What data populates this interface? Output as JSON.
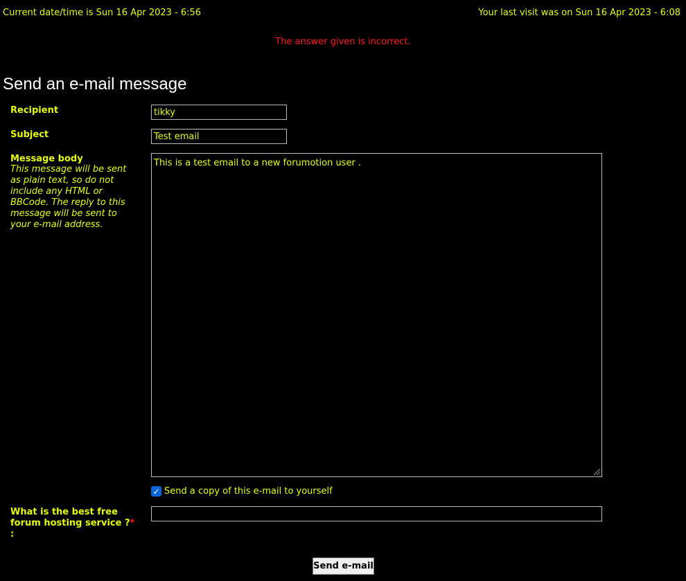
{
  "header": {
    "current_datetime": "Current date/time is Sun 16 Apr 2023 - 6:56",
    "last_visit": "Your last visit was on Sun 16 Apr 2023 - 6:08"
  },
  "error_message": "The answer given is incorrect.",
  "page_title": "Send an e-mail message",
  "form": {
    "recipient_label": "Recipient",
    "recipient_value": "tikky",
    "subject_label": "Subject",
    "subject_value": "Test email",
    "message_label": "Message body",
    "message_description": "This message will be sent as plain text, so do not include any HTML or BBCode. The reply to this message will be sent to your e-mail address.",
    "message_value": "This is a test email to a new forumotion user .",
    "copy_label": "Send a copy of this e-mail to yourself",
    "copy_checked": true,
    "question_label": "What is the best free forum hosting service ?",
    "required_mark": "*",
    "question_colon": ":",
    "answer_value": "",
    "submit_label": "Send e-mail"
  },
  "colors": {
    "text": "#e6ff00",
    "error": "#ff1a1a",
    "background": "#000000",
    "checkbox": "#0a64d8"
  }
}
